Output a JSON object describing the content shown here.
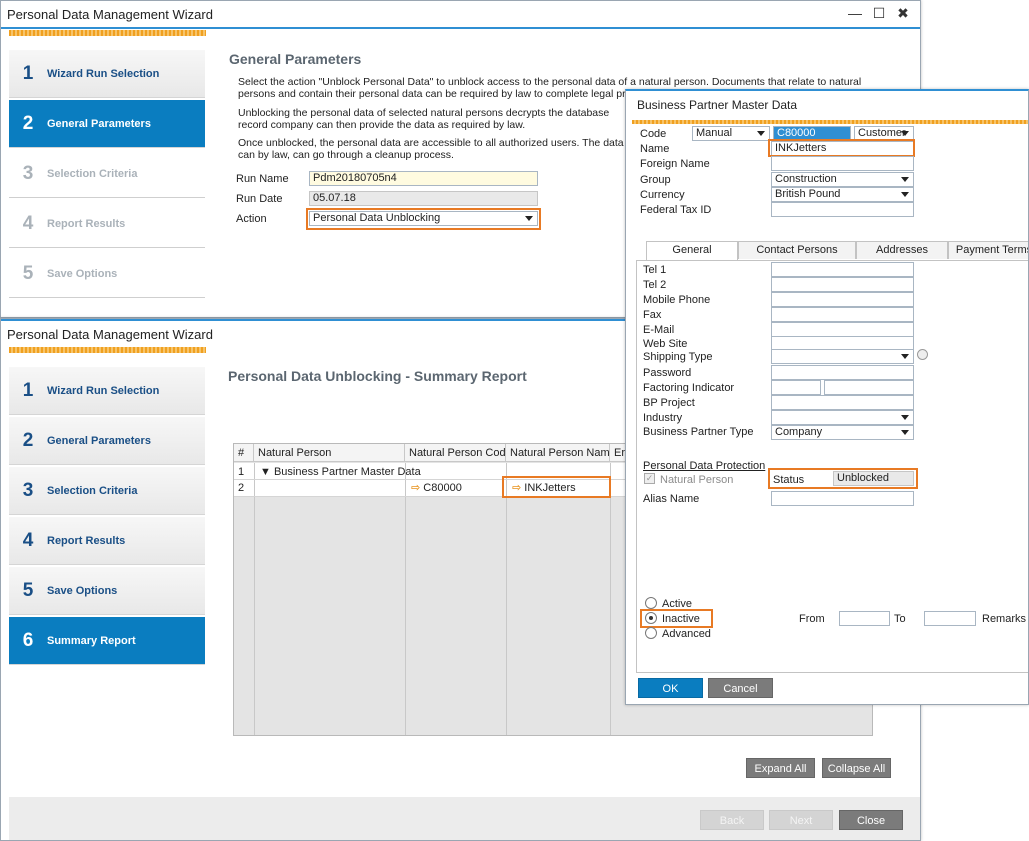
{
  "win1": {
    "title": "Personal Data Management Wizard",
    "steps": [
      {
        "num": "1",
        "label": "Wizard Run Selection"
      },
      {
        "num": "2",
        "label": "General Parameters"
      },
      {
        "num": "3",
        "label": "Selection Criteria"
      },
      {
        "num": "4",
        "label": "Report Results"
      },
      {
        "num": "5",
        "label": "Save Options"
      }
    ],
    "heading": "General Parameters",
    "para1": "Select the action \"Unblock Personal Data\" to unblock access to the personal data of a natural person. Documents that relate to natural persons and contain their personal data can be required by law to complete legal processes.",
    "para2": "Unblocking the personal data of selected natural persons decrypts the database record company can then provide the data as required by law.",
    "para3": "Once unblocked, the personal data are accessible to all authorized users. The data can by law, can go through a cleanup process.",
    "run_name_label": "Run Name",
    "run_name": "Pdm20180705n4",
    "run_date_label": "Run Date",
    "run_date": "05.07.18",
    "action_label": "Action",
    "action": "Personal Data Unblocking"
  },
  "win2": {
    "title": "Personal Data Management Wizard",
    "steps": [
      {
        "num": "1",
        "label": "Wizard Run Selection"
      },
      {
        "num": "2",
        "label": "General Parameters"
      },
      {
        "num": "3",
        "label": "Selection Criteria"
      },
      {
        "num": "4",
        "label": "Report Results"
      },
      {
        "num": "5",
        "label": "Save Options"
      },
      {
        "num": "6",
        "label": "Summary Report"
      }
    ],
    "heading": "Personal Data Unblocking - Summary Report",
    "columns": [
      "#",
      "Natural Person",
      "Natural Person Code",
      "Natural Person Name",
      "Er"
    ],
    "rows": [
      {
        "num": "1",
        "person": "Business Partner Master Data",
        "code": "",
        "name": ""
      },
      {
        "num": "2",
        "person": "",
        "code": "C80000",
        "name": "INKJetters"
      }
    ],
    "expand_all": "Expand All",
    "collapse_all": "Collapse All",
    "back": "Back",
    "next": "Next",
    "close": "Close"
  },
  "bp": {
    "title": "Business Partner Master Data",
    "code_label": "Code",
    "code_series": "Manual",
    "code": "C80000",
    "type": "Customer",
    "name_label": "Name",
    "name": "INKJetters",
    "foreign_name_label": "Foreign Name",
    "group_label": "Group",
    "group": "Construction",
    "currency_label": "Currency",
    "currency": "British Pound",
    "fed_tax_label": "Federal Tax ID",
    "tabs": [
      "General",
      "Contact Persons",
      "Addresses",
      "Payment Terms"
    ],
    "general_fields": [
      "Tel 1",
      "Tel 2",
      "Mobile Phone",
      "Fax",
      "E-Mail",
      "Web Site",
      "Shipping Type",
      "Password",
      "Factoring Indicator",
      "BP Project",
      "Industry",
      "Business Partner Type"
    ],
    "bp_type_value": "Company",
    "pdp_label": "Personal Data Protection",
    "natural_person_label": "Natural Person",
    "status_label": "Status",
    "status_value": "Unblocked",
    "alias_label": "Alias Name",
    "active_label": "Active",
    "inactive_label": "Inactive",
    "advanced_label": "Advanced",
    "from_label": "From",
    "to_label": "To",
    "remarks_label": "Remarks",
    "ok": "OK",
    "cancel": "Cancel"
  },
  "colors": {
    "accent": "#2f8fd3",
    "active_step": "#0a7dc0",
    "highlight": "#e87a24"
  }
}
